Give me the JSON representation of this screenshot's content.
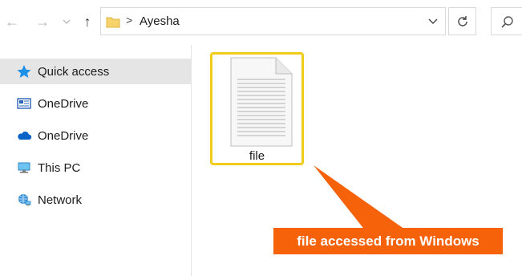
{
  "window": {
    "address": {
      "path": "Ayesha",
      "separator": ">"
    }
  },
  "sidebar": {
    "items": [
      {
        "label": "Quick access",
        "icon": "star-icon",
        "selected": true
      },
      {
        "label": "OneDrive",
        "icon": "onedrive-tile-icon",
        "selected": false
      },
      {
        "label": "OneDrive",
        "icon": "cloud-icon",
        "selected": false
      },
      {
        "label": "This PC",
        "icon": "computer-icon",
        "selected": false
      },
      {
        "label": "Network",
        "icon": "network-icon",
        "selected": false
      }
    ]
  },
  "content": {
    "files": [
      {
        "name": "file",
        "icon": "document-icon",
        "selected": true
      }
    ]
  },
  "annotation": {
    "text": "file accessed from Windows",
    "color": "#f5620a"
  },
  "colors": {
    "selection_highlight": "#f2cc1a",
    "nav_selected_bg": "#e5e5e5",
    "accent_blue": "#1e90e8"
  }
}
